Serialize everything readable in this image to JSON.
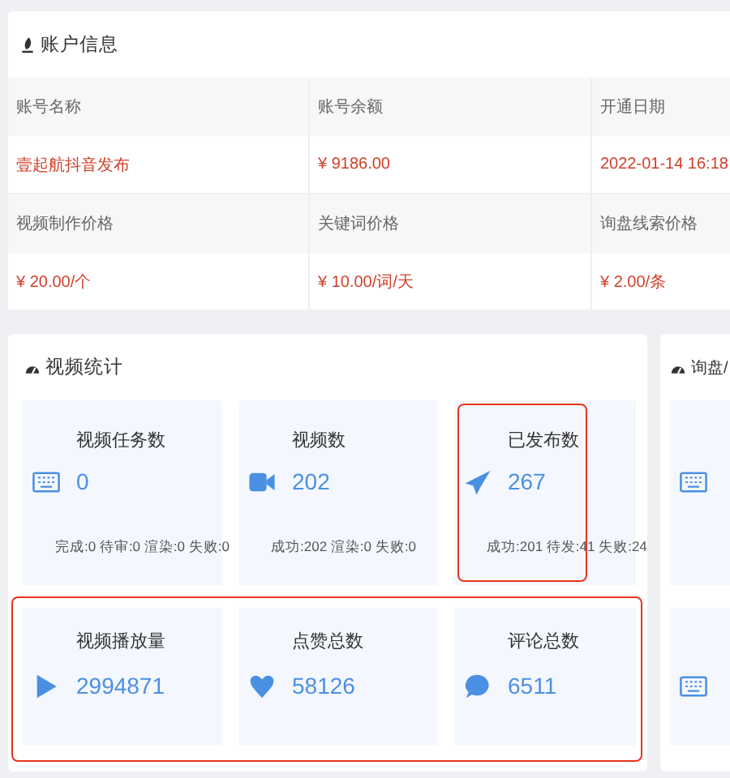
{
  "account_panel": {
    "title": "账户信息",
    "rows": [
      {
        "kind": "header",
        "cells": [
          "账号名称",
          "账号余额",
          "开通日期"
        ]
      },
      {
        "kind": "value",
        "cells": [
          "壹起航抖音发布",
          "¥ 9186.00",
          "2022-01-14 16:18"
        ]
      },
      {
        "kind": "header",
        "cells": [
          "视频制作价格",
          "关键词价格",
          "询盘线索价格"
        ]
      },
      {
        "kind": "value",
        "cells": [
          "¥ 20.00/个",
          "¥ 10.00/词/天",
          "¥ 2.00/条"
        ]
      }
    ]
  },
  "video_stats": {
    "title": "视频统计",
    "card_rows": [
      {
        "highlighted": false,
        "cards": [
          {
            "title": "视频任务数",
            "value": "0",
            "details": "完成:0 待审:0 渲染:0 失败:0",
            "highlighted": false
          },
          {
            "title": "视频数",
            "value": "202",
            "details": "成功:202  渲染:0  失败:0",
            "highlighted": false
          },
          {
            "title": "已发布数",
            "value": "267",
            "details": "成功:201  待发:41 失败:24",
            "highlighted": true
          }
        ]
      },
      {
        "highlighted": true,
        "cards": [
          {
            "title": "视频播放量",
            "value": "2994871",
            "highlighted": false
          },
          {
            "title": "点赞总数",
            "value": "58126",
            "highlighted": false
          },
          {
            "title": "评论总数",
            "value": "6511",
            "highlighted": false
          }
        ]
      }
    ]
  },
  "inquiry_stats": {
    "title": "询盘/"
  }
}
